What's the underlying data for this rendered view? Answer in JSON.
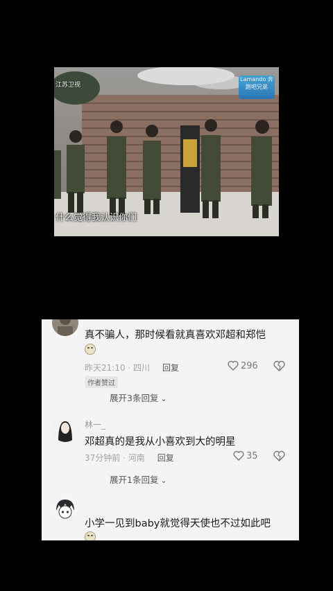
{
  "video": {
    "subtitle": "什么觉得我认识你们",
    "channel_logo_left": "江苏卫视",
    "channel_logo_right": "Lamando 奔跑吧兄弟"
  },
  "comments": [
    {
      "username": "",
      "text": "真不骗人，那时候看就真喜欢邓超和郑恺",
      "emoji": "smile-emoji",
      "time": "昨天21:10 · 四川",
      "reply_label": "回复",
      "likes": "296",
      "badge": "作者赞过",
      "expand_label": "展开3条回复"
    },
    {
      "username": "林一_",
      "text": "邓超真的是我从小喜欢到大的明星",
      "time": "37分钟前 · 河南",
      "reply_label": "回复",
      "likes": "35",
      "expand_label": "展开1条回复"
    },
    {
      "username": "",
      "text": "小学一见到baby就觉得天使也不过如此吧",
      "emoji": "smile-emoji"
    }
  ],
  "colors": {
    "page_background": "#000000",
    "comment_panel": "#f4f4f4",
    "meta_text": "#a3a3a3"
  }
}
